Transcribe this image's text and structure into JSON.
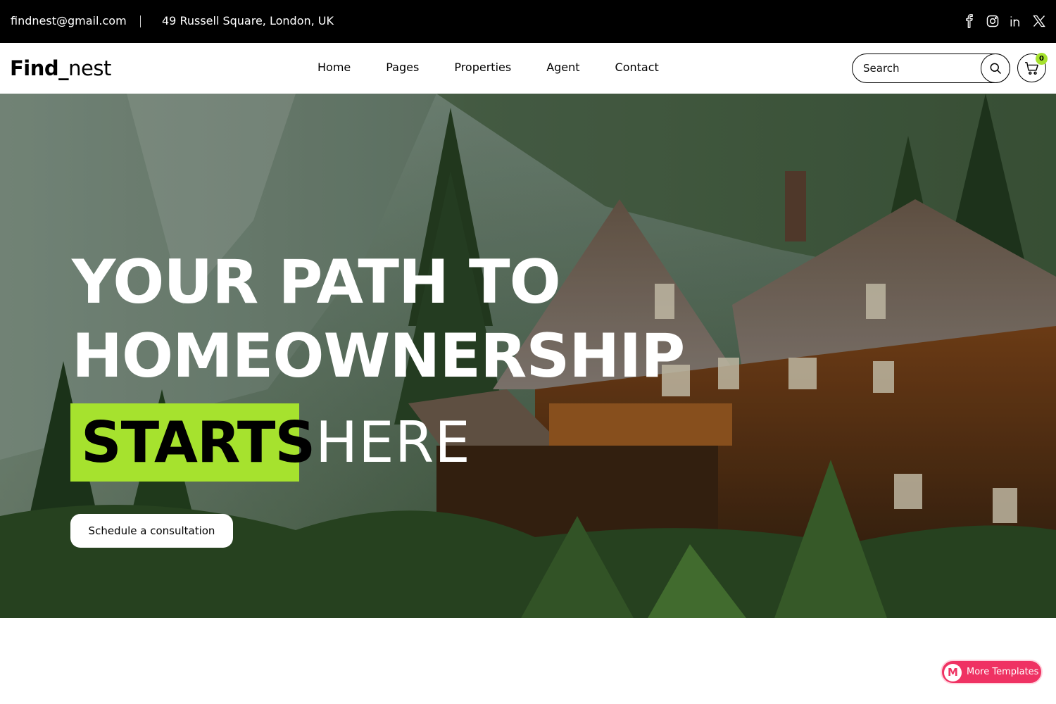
{
  "topbar": {
    "email": "findnest@gmail.com",
    "address": "49 Russell Square, London, UK",
    "socials": [
      "facebook-icon",
      "instagram-icon",
      "linkedin-icon",
      "x-twitter-icon"
    ]
  },
  "header": {
    "logo_bold": "Find_",
    "logo_regular": "nest",
    "nav": [
      "Home",
      "Pages",
      "Properties",
      "Agent",
      "Contact"
    ],
    "search_placeholder": "Search",
    "cart_count": "0"
  },
  "hero": {
    "line1": "YOUR PATH TO",
    "line2": "HOMEOWNERSHIP",
    "highlight": "STARTS",
    "line3_rest": "HERE",
    "cta": "Schedule a consultation",
    "background": "mountain-forest-log-cabin-photo"
  },
  "floating": {
    "more_templates_icon": "M",
    "more_templates_label": "More Templates"
  },
  "colors": {
    "topbar_bg": "#000000",
    "accent_green": "#a6e22e",
    "badge_pink": "#ef3263"
  }
}
